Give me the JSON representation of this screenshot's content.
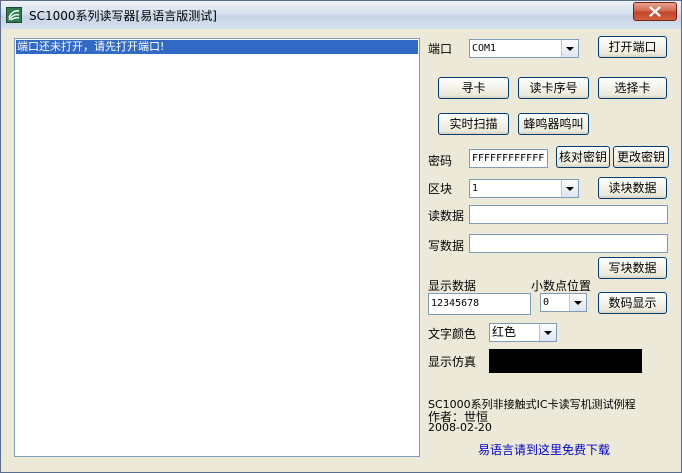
{
  "window": {
    "title": "SC1000系列读写器[易语言版测试]"
  },
  "log": {
    "message": "端口还未打开，请先打开端口!"
  },
  "port": {
    "label": "端口",
    "value": "COM1",
    "open_button": "打开端口"
  },
  "card_buttons": {
    "find_card": "寻卡",
    "read_serial": "读卡序号",
    "select_card": "选择卡",
    "realtime_scan": "实时扫描",
    "buzzer": "蜂鸣器鸣叫"
  },
  "password": {
    "label": "密码",
    "value": "FFFFFFFFFFFF",
    "verify_button": "核对密钥",
    "change_button": "更改密钥"
  },
  "block": {
    "label": "区块",
    "value": "1",
    "read_button": "读块数据"
  },
  "read_data": {
    "label": "读数据",
    "value": ""
  },
  "write_data": {
    "label": "写数据",
    "value": "",
    "write_button": "写块数据"
  },
  "display": {
    "label": "显示数据",
    "value": "12345678",
    "decimal_label": "小数点位置",
    "decimal_value": "0",
    "digital_button": "数码显示"
  },
  "text_color": {
    "label": "文字颜色",
    "value": "红色"
  },
  "simulation": {
    "label": "显示仿真",
    "background": "#000000"
  },
  "footer": {
    "line1": "SC1000系列非接触式IC卡读写机测试例程",
    "line2": "作者：世恒",
    "line3": "2008-02-20",
    "link": "易语言请到这里免费下载"
  }
}
